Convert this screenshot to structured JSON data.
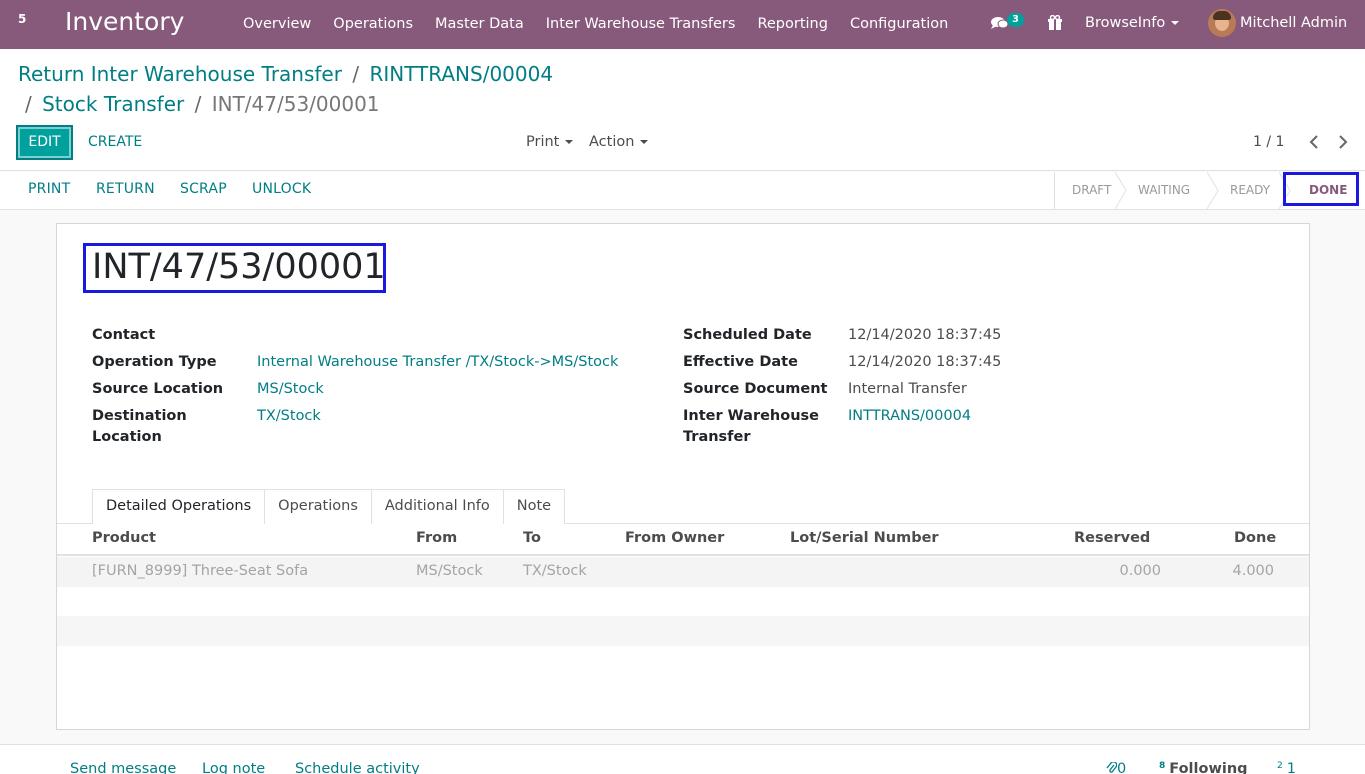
{
  "navbar": {
    "apps_indicator": "5",
    "brand": "Inventory",
    "menu": [
      "Overview",
      "Operations",
      "Master Data",
      "Inter Warehouse Transfers",
      "Reporting",
      "Configuration"
    ],
    "chat_badge": "3",
    "company": "BrowseInfo",
    "user": "Mitchell Admin"
  },
  "breadcrumb": {
    "item1": "Return Inter Warehouse Transfer",
    "item2": "RINTTRANS/00004",
    "item3": "Stock Transfer",
    "current": "INT/47/53/00001",
    "separator": "/"
  },
  "control": {
    "edit_label": "EDIT",
    "create_label": "CREATE",
    "print_label": "Print",
    "action_label": "Action",
    "pager": "1 / 1"
  },
  "statusbar": {
    "buttons": [
      "PRINT",
      "RETURN",
      "SCRAP",
      "UNLOCK"
    ],
    "states": [
      "DRAFT",
      "WAITING",
      "READY",
      "DONE"
    ],
    "active_state": "DONE"
  },
  "record": {
    "name": "INT/47/53/00001",
    "left_fields": [
      {
        "label": "Contact",
        "value": ""
      },
      {
        "label": "Operation Type",
        "value": "Internal Warehouse Transfer /TX/Stock->MS/Stock"
      },
      {
        "label": "Source Location",
        "value": "MS/Stock"
      },
      {
        "label": "Destination Location",
        "value": "TX/Stock"
      }
    ],
    "right_fields": [
      {
        "label": "Scheduled Date",
        "value": "12/14/2020 18:37:45"
      },
      {
        "label": "Effective Date",
        "value": "12/14/2020 18:37:45"
      },
      {
        "label": "Source Document",
        "value": "Internal Transfer"
      },
      {
        "label": "Inter Warehouse Transfer",
        "value": "INTTRANS/00004"
      }
    ]
  },
  "tabs": [
    "Detailed Operations",
    "Operations",
    "Additional Info",
    "Note"
  ],
  "table": {
    "columns": [
      "Product",
      "From",
      "To",
      "From Owner",
      "Lot/Serial Number",
      "Reserved",
      "Done"
    ],
    "rows": [
      {
        "product": "[FURN_8999] Three-Seat Sofa",
        "from": "MS/Stock",
        "to": "TX/Stock",
        "owner": "",
        "lot": "",
        "reserved": "0.000",
        "done": "4.000"
      }
    ]
  },
  "chatter": {
    "send_message": "Send message",
    "log_note": "Log note",
    "schedule_activity": "Schedule activity",
    "attachments": "0",
    "followers_count": "8",
    "following_label": "Following",
    "other_count": "2",
    "other_value": "1"
  },
  "colors": {
    "navbar": "#875a7b",
    "accent": "#017e84",
    "primary_button": "#00a09d",
    "highlight": "#1a1adf"
  }
}
